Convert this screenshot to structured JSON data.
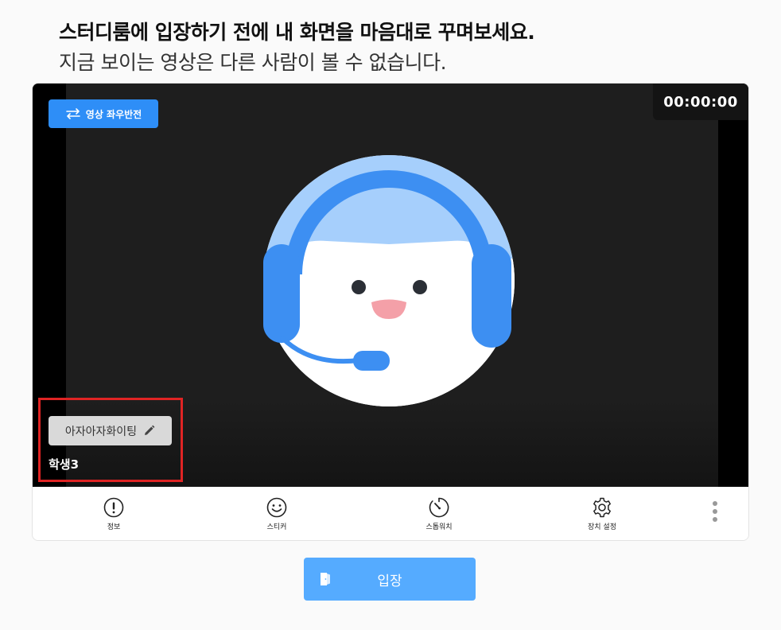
{
  "header": {
    "title": "스터디룸에 입장하기 전에 내 화면을 마음대로 꾸며보세요.",
    "subtitle": "지금 보이는 영상은 다른 사람이 볼 수 없습니다."
  },
  "video": {
    "mirror_label": "영상 좌우반전",
    "timer": "00:00:00",
    "status_message": "아자아자화이팅",
    "username": "학생3"
  },
  "toolbar": {
    "items": [
      {
        "label": "정보",
        "icon": "info-icon"
      },
      {
        "label": "스티커",
        "icon": "smile-icon"
      },
      {
        "label": "스톱워치",
        "icon": "stopwatch-icon"
      },
      {
        "label": "장치 설정",
        "icon": "gear-icon"
      }
    ],
    "more_icon": "more-vertical-icon"
  },
  "enter_button": {
    "label": "입장",
    "icon": "door-icon"
  },
  "colors": {
    "accent": "#2e8ef7",
    "enter_button": "#55abff",
    "highlight": "#e02424",
    "video_bg": "#1e1e1e"
  }
}
